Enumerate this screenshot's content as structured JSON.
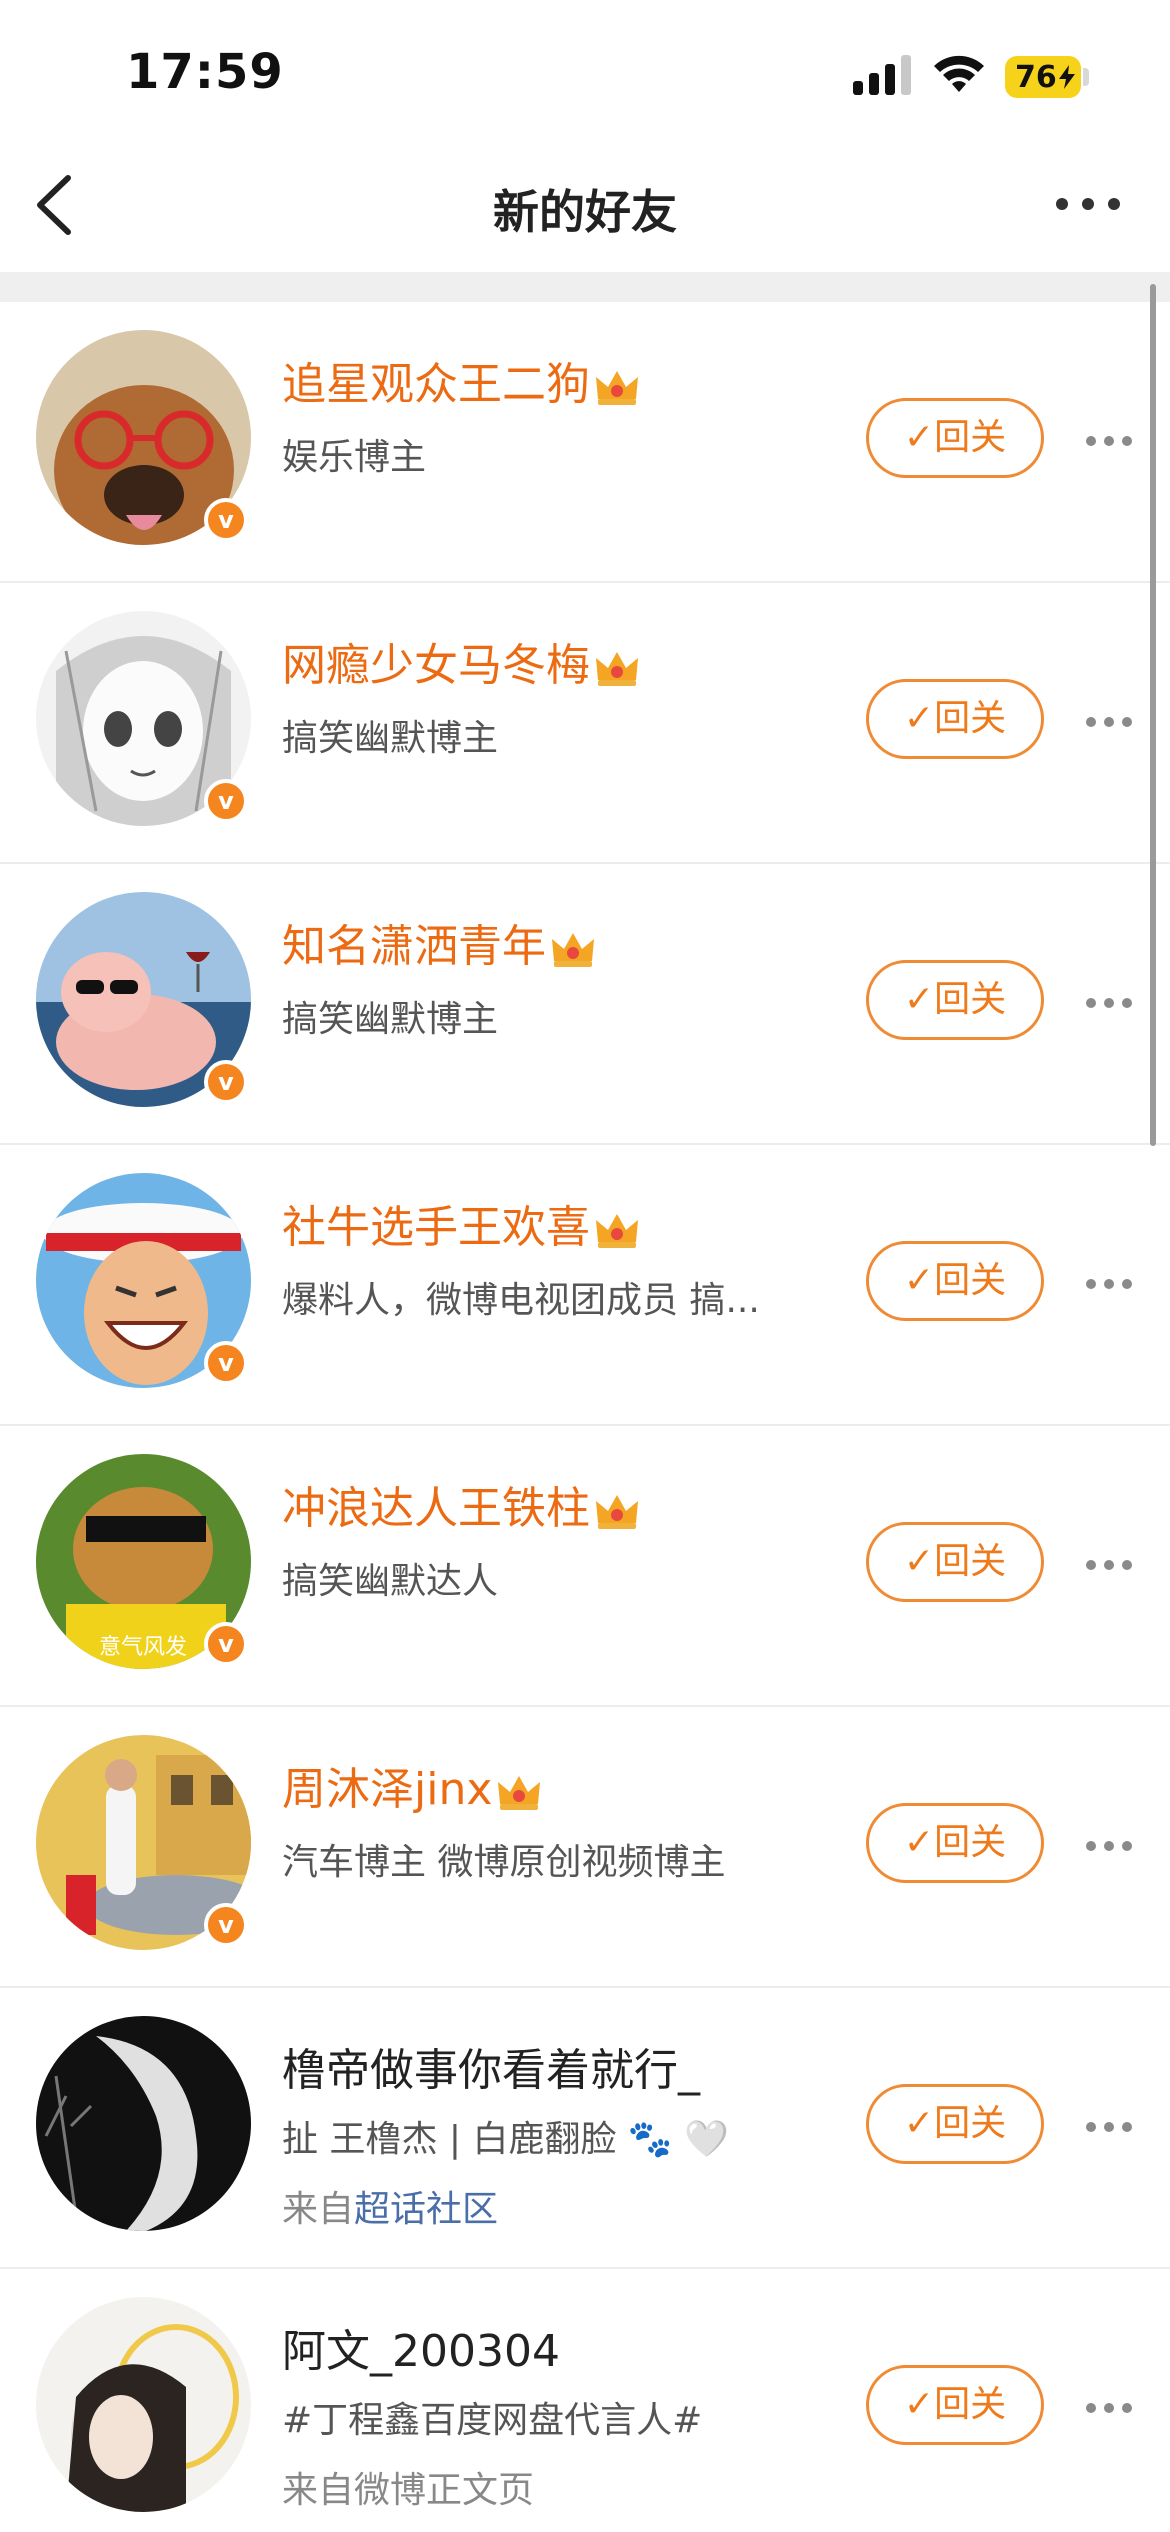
{
  "status_bar": {
    "time": "17:59",
    "battery": "76"
  },
  "nav": {
    "title": "新的好友"
  },
  "colors": {
    "accent": "#ef7a1c",
    "verified": "#f5861f",
    "name_vip": "#ec6a12",
    "link": "#4a6ea8"
  },
  "friends": [
    {
      "name": "追星观众王二狗",
      "vip": true,
      "verified": true,
      "desc": "娱乐博主",
      "button": "✓回关"
    },
    {
      "name": "网瘾少女马冬梅",
      "vip": true,
      "verified": true,
      "desc": "搞笑幽默博主",
      "button": "✓回关"
    },
    {
      "name": "知名潇洒青年",
      "vip": true,
      "verified": true,
      "desc": "搞笑幽默博主",
      "button": "✓回关"
    },
    {
      "name": "社牛选手王欢喜",
      "vip": true,
      "verified": true,
      "desc": "爆料人，微博电视团成员 搞...",
      "button": "✓回关"
    },
    {
      "name": "冲浪达人王铁柱",
      "vip": true,
      "verified": true,
      "desc": "搞笑幽默达人",
      "avatar_text": "意气风发",
      "button": "✓回关"
    },
    {
      "name": "周沐泽jinx",
      "vip": true,
      "verified": true,
      "desc": "汽车博主 微博原创视频博主",
      "button": "✓回关"
    },
    {
      "name": "橹帝做事你看着就行_",
      "vip": false,
      "verified": false,
      "desc": "扯 王橹杰 | 白鹿翻脸 🐾 🤍",
      "source_prefix": "来自",
      "source_link": "超话社区",
      "button": "✓回关"
    },
    {
      "name": "阿文_200304",
      "vip": false,
      "verified": false,
      "desc": "#丁程鑫百度网盘代言人#",
      "source_prefix": "来自微博正文页",
      "source_link": "",
      "button": "✓回关"
    }
  ]
}
